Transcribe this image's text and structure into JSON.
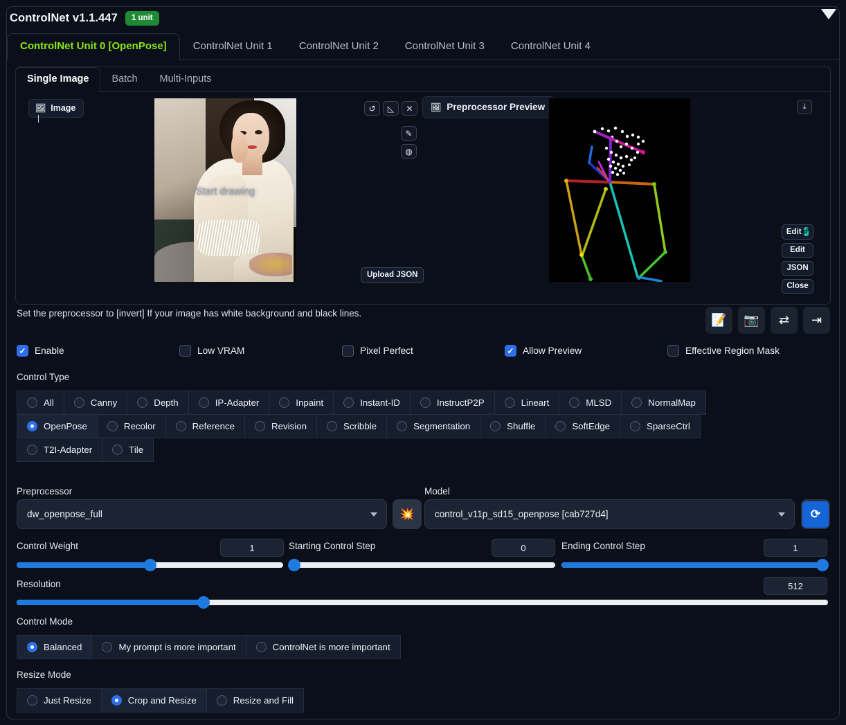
{
  "header": {
    "title": "ControlNet v1.1.447",
    "badge": "1 unit",
    "collapse_icon": "chevron-down-icon",
    "badge_color": "#1f8a35"
  },
  "unit_tabs": [
    {
      "label": "ControlNet Unit 0 [OpenPose]",
      "active": true
    },
    {
      "label": "ControlNet Unit 1",
      "active": false
    },
    {
      "label": "ControlNet Unit 2",
      "active": false
    },
    {
      "label": "ControlNet Unit 3",
      "active": false
    },
    {
      "label": "ControlNet Unit 4",
      "active": false
    }
  ],
  "sub_tabs": [
    {
      "label": "Single Image",
      "active": true
    },
    {
      "label": "Batch",
      "active": false
    },
    {
      "label": "Multi-Inputs",
      "active": false
    }
  ],
  "workspace": {
    "image_tab_label": "Image",
    "image_tab_icon": "image-icon",
    "canvas_overlay_text": "Start drawing",
    "tools": [
      {
        "name": "undo-icon",
        "glyph": "↺"
      },
      {
        "name": "eraser-icon",
        "glyph": "◇"
      },
      {
        "name": "clear-canvas-icon",
        "glyph": "✕"
      },
      {
        "name": "brush-icon",
        "glyph": "✎"
      },
      {
        "name": "color-palette-icon",
        "glyph": "◍"
      }
    ],
    "preview_tab_label": "Preprocessor Preview",
    "preview_tab_icon": "image-icon",
    "upload_json_label": "Upload JSON",
    "download_icon": "download-icon",
    "side_buttons": [
      {
        "label": "Edit",
        "icon": "photopea-icon"
      },
      {
        "label": "Edit",
        "icon": ""
      },
      {
        "label": "JSON",
        "icon": ""
      },
      {
        "label": "Close",
        "icon": ""
      }
    ]
  },
  "hint": "Set the preprocessor to [invert] If your image has white background and black lines.",
  "action_icons": [
    {
      "name": "send-to-txt2img-icon",
      "glyph": "📝"
    },
    {
      "name": "webcam-icon",
      "glyph": "📷"
    },
    {
      "name": "swap-icon",
      "glyph": "⇄"
    },
    {
      "name": "send-dimensions-icon",
      "glyph": "⇥"
    }
  ],
  "checkboxes": [
    {
      "label": "Enable",
      "checked": true
    },
    {
      "label": "Low VRAM",
      "checked": false
    },
    {
      "label": "Pixel Perfect",
      "checked": false
    },
    {
      "label": "Allow Preview",
      "checked": true
    },
    {
      "label": "Effective Region Mask",
      "checked": false
    }
  ],
  "control_type": {
    "label": "Control Type",
    "options": [
      {
        "label": "All",
        "selected": false
      },
      {
        "label": "Canny",
        "selected": false
      },
      {
        "label": "Depth",
        "selected": false
      },
      {
        "label": "IP-Adapter",
        "selected": false
      },
      {
        "label": "Inpaint",
        "selected": false
      },
      {
        "label": "Instant-ID",
        "selected": false
      },
      {
        "label": "InstructP2P",
        "selected": false
      },
      {
        "label": "Lineart",
        "selected": false
      },
      {
        "label": "MLSD",
        "selected": false
      },
      {
        "label": "NormalMap",
        "selected": false
      },
      {
        "label": "OpenPose",
        "selected": true
      },
      {
        "label": "Recolor",
        "selected": false
      },
      {
        "label": "Reference",
        "selected": false
      },
      {
        "label": "Revision",
        "selected": false
      },
      {
        "label": "Scribble",
        "selected": false
      },
      {
        "label": "Segmentation",
        "selected": false
      },
      {
        "label": "Shuffle",
        "selected": false
      },
      {
        "label": "SoftEdge",
        "selected": false
      },
      {
        "label": "SparseCtrl",
        "selected": false
      },
      {
        "label": "T2I-Adapter",
        "selected": false
      },
      {
        "label": "Tile",
        "selected": false
      }
    ]
  },
  "preprocessor": {
    "label": "Preprocessor",
    "value": "dw_openpose_full",
    "run_icon": "explosion-icon",
    "run_glyph": "💥"
  },
  "model": {
    "label": "Model",
    "value": "control_v11p_sd15_openpose [cab727d4]",
    "refresh_icon": "refresh-icon",
    "refresh_glyph": "⟳",
    "refresh_color": "#1565d8"
  },
  "sliders": {
    "control_weight": {
      "label": "Control Weight",
      "value": "1",
      "percent": 50
    },
    "starting_control_step": {
      "label": "Starting Control Step",
      "value": "0",
      "percent": 0
    },
    "ending_control_step": {
      "label": "Ending Control Step",
      "value": "1",
      "percent": 100
    },
    "resolution": {
      "label": "Resolution",
      "value": "512",
      "percent": 23
    }
  },
  "control_mode": {
    "label": "Control Mode",
    "options": [
      {
        "label": "Balanced",
        "selected": true
      },
      {
        "label": "My prompt is more important",
        "selected": false
      },
      {
        "label": "ControlNet is more important",
        "selected": false
      }
    ]
  },
  "resize_mode": {
    "label": "Resize Mode",
    "options": [
      {
        "label": "Just Resize",
        "selected": false
      },
      {
        "label": "Crop and Resize",
        "selected": true
      },
      {
        "label": "Resize and Fill",
        "selected": false
      }
    ]
  }
}
